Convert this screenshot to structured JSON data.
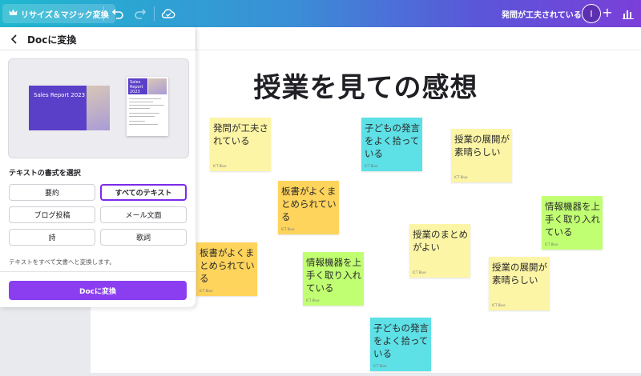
{
  "topbar": {
    "magic_label": "リサイズ＆マジック変換",
    "doc_title": "発問が工夫されている",
    "avatar_initial": "I",
    "plus_label": "+"
  },
  "canvas": {
    "title": "授業を見ての感想",
    "notes": [
      {
        "text": "発問が工夫されている",
        "sub": "ICT Blue",
        "color": "#fdf5a6"
      },
      {
        "text": "子どもの発言をよく拾っている",
        "sub": "ICT Blue",
        "color": "#5de0e6"
      },
      {
        "text": "授業の展開が素晴らしい",
        "sub": "ICT Blue",
        "color": "#fdf5a6"
      },
      {
        "text": "板書がよくまとめられている",
        "sub": "ICT Blue",
        "color": "#ffd45c"
      },
      {
        "text": "情報機器を上手く取り入れている",
        "sub": "ICT Blue",
        "color": "#c1ff72"
      },
      {
        "text": "授業のまとめがよい",
        "sub": "ICT Blue",
        "color": "#fdf5a6"
      },
      {
        "text": "板書がよくまとめられている",
        "sub": "ICT Blue",
        "color": "#ffd45c"
      },
      {
        "text": "情報機器を上手く取り入れている",
        "sub": "ICT Blue",
        "color": "#c1ff72"
      },
      {
        "text": "授業の展開が素晴らしい",
        "sub": "ICT Blue",
        "color": "#fdf5a6"
      },
      {
        "text": "子どもの発言をよく拾っている",
        "sub": "ICT Blue",
        "color": "#5de0e6"
      }
    ]
  },
  "panel": {
    "title": "Docに変換",
    "preview_slide_title": "Sales Report 2023",
    "preview_doc_title": "Sales Report 2023",
    "format_label": "テキストの書式を選択",
    "options": [
      "要約",
      "すべてのテキスト",
      "ブログ投稿",
      "メール文面",
      "詩",
      "歌詞"
    ],
    "selected_option": "すべてのテキスト",
    "hint": "テキストをすべて文書へと変換します。",
    "convert_button": "Docに変換"
  },
  "colors": {
    "accent": "#8b3ef0",
    "selected_border": "#7d2ae8"
  }
}
